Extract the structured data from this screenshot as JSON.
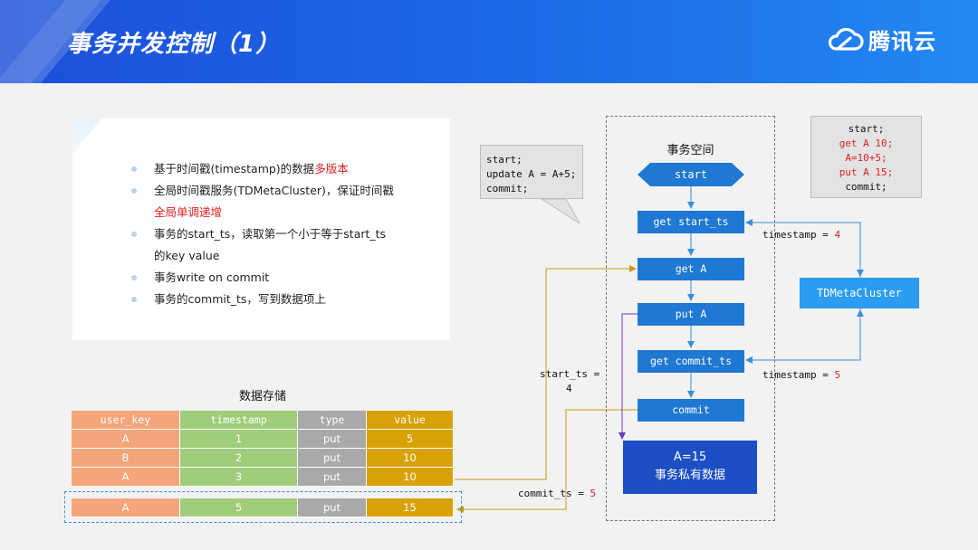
{
  "header": {
    "title": "事务并发控制（1）",
    "logo_text": "腾讯云"
  },
  "bullets": [
    {
      "parts": [
        {
          "text": "基于时间戳(timestamp)的数据",
          "red": false
        },
        {
          "text": "多版本",
          "red": true
        }
      ],
      "bullet": true
    },
    {
      "parts": [
        {
          "text": "全局时间戳服务(TDMetaCluster)，保证时间戳",
          "red": false
        }
      ],
      "bullet": true
    },
    {
      "parts": [
        {
          "text": "全局单调递增",
          "red": true
        }
      ],
      "bullet": false
    },
    {
      "parts": [
        {
          "text": "事务的start_ts，读取第一个小于等于start_ts",
          "red": false
        }
      ],
      "bullet": true
    },
    {
      "parts": [
        {
          "text": "的key value",
          "red": false
        }
      ],
      "bullet": false
    },
    {
      "parts": [
        {
          "text": "事务write on commit",
          "red": false
        }
      ],
      "bullet": true
    },
    {
      "parts": [
        {
          "text": "事务的commit_ts，写到数据项上",
          "red": false
        }
      ],
      "bullet": true
    }
  ],
  "callout": {
    "lines": [
      "start;",
      "update A = A+5;",
      "commit;"
    ]
  },
  "space": {
    "title": "事务空间",
    "start": "start",
    "steps": [
      "get start_ts",
      "get A",
      "put A",
      "get commit_ts",
      "commit"
    ],
    "private_lines": [
      "A=15",
      "事务私有数据"
    ]
  },
  "info_box": {
    "lines": [
      {
        "text": "start;",
        "red": false
      },
      {
        "text": "get A 10;",
        "red": true
      },
      {
        "text": "A=10+5;",
        "red": true
      },
      {
        "text": "put A 15;",
        "red": true
      },
      {
        "text": "commit;",
        "red": false
      }
    ]
  },
  "tdmeta": "TDMetaCluster",
  "labels": {
    "ts1_prefix": "timestamp = ",
    "ts1_value": "4",
    "ts2_prefix": "timestamp = ",
    "ts2_value": "5",
    "start_ts_prefix": "start_ts =",
    "start_ts_value": "4",
    "commit_ts_prefix": "commit_ts = ",
    "commit_ts_value": "5"
  },
  "storage": {
    "title": "数据存储",
    "columns": [
      "user_key",
      "timestamp",
      "type",
      "value"
    ],
    "rows": [
      [
        "A",
        "1",
        "put",
        "5"
      ],
      [
        "B",
        "2",
        "put",
        "10"
      ],
      [
        "A",
        "3",
        "put",
        "10"
      ]
    ],
    "new_row": [
      "A",
      "5",
      "put",
      "15"
    ]
  },
  "colors": {
    "accent": "#1f78d1",
    "red": "#e02020",
    "gold": "#d8a106",
    "purple": "#6a3ab8"
  }
}
